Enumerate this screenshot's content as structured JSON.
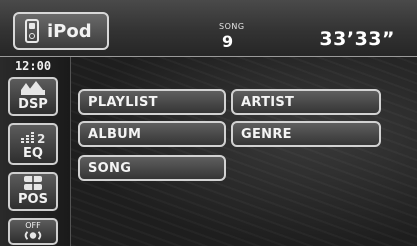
{
  "header": {
    "source_label": "iPod",
    "song_label": "SONG",
    "song_number": "9",
    "elapsed_time": "33’33”"
  },
  "sidebar": {
    "clock": "12:00",
    "buttons": [
      {
        "label": "DSP",
        "icon": "dsp-icon"
      },
      {
        "label": "EQ",
        "icon": "eq-icon",
        "badge": "2"
      },
      {
        "label": "POS",
        "icon": "position-icon"
      },
      {
        "label": "OFF",
        "icon": "surround-off-icon"
      }
    ]
  },
  "menu": {
    "items": [
      {
        "label": "PLAYLIST"
      },
      {
        "label": "ARTIST"
      },
      {
        "label": "ALBUM"
      },
      {
        "label": "GENRE"
      },
      {
        "label": "SONG"
      }
    ]
  }
}
